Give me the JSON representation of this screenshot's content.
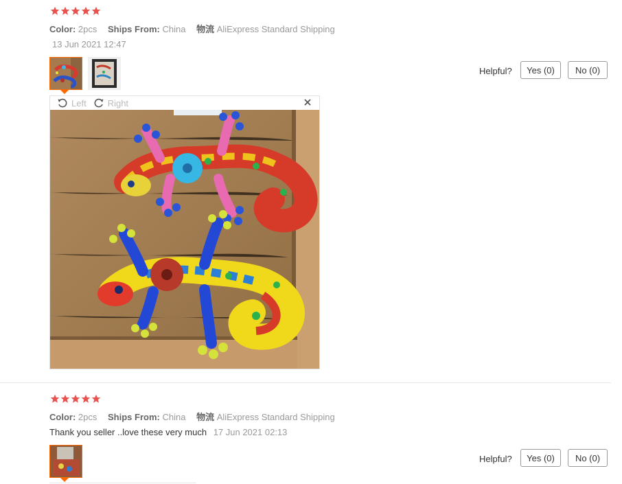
{
  "colors": {
    "star": "#e9534f",
    "accent": "#ff6a00",
    "muted": "#999999"
  },
  "reviews": [
    {
      "rating": 5,
      "color_label": "Color:",
      "color_value": "2pcs",
      "ships_label": "Ships From:",
      "ships_value": "China",
      "logistics_label": "物流",
      "logistics_value": "AliExpress Standard Shipping",
      "feedback": "",
      "date": "13 Jun 2021 12:47",
      "helpful_label": "Helpful?",
      "yes_label": "Yes (0)",
      "no_label": "No (0)",
      "viewer": {
        "left_label": "Left",
        "right_label": "Right"
      }
    },
    {
      "rating": 5,
      "color_label": "Color:",
      "color_value": "2pcs",
      "ships_label": "Ships From:",
      "ships_value": "China",
      "logistics_label": "物流",
      "logistics_value": "AliExpress Standard Shipping",
      "feedback": "Thank you seller ..love these very much",
      "date": "17 Jun 2021 02:13",
      "helpful_label": "Helpful?",
      "yes_label": "Yes (0)",
      "no_label": "No (0)"
    }
  ],
  "icons": {
    "star": "star-icon",
    "rotate_left": "rotate-left-icon",
    "rotate_right": "rotate-right-icon",
    "close": "close-icon"
  }
}
